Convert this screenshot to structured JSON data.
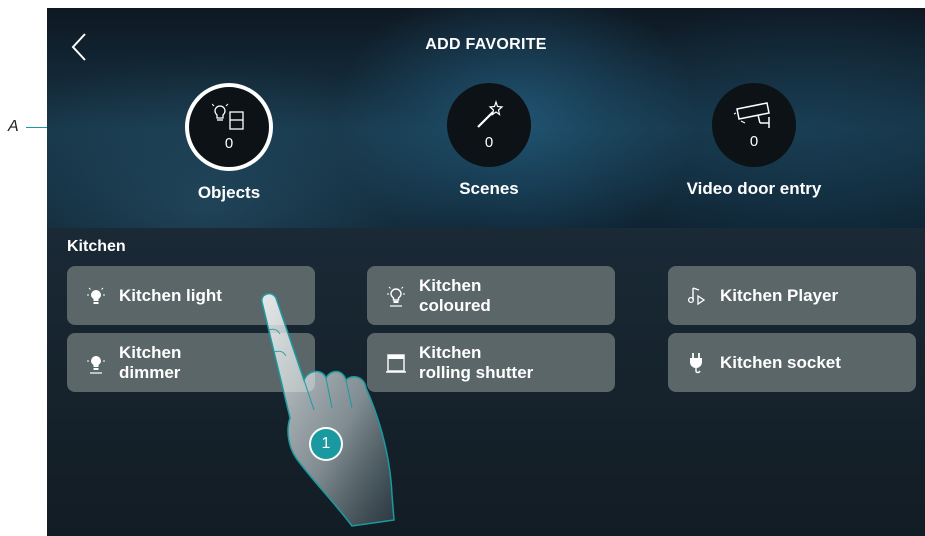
{
  "callout": {
    "letter": "A"
  },
  "header": {
    "title": "ADD FAVORITE"
  },
  "categories": [
    {
      "label": "Objects",
      "count": "0",
      "icon": "bulb-switch-icon",
      "active": true
    },
    {
      "label": "Scenes",
      "count": "0",
      "icon": "magic-wand-icon",
      "active": false
    },
    {
      "label": "Video door entry",
      "count": "0",
      "icon": "camera-icon",
      "active": false
    }
  ],
  "room": {
    "name": "Kitchen"
  },
  "devices": [
    {
      "label": "Kitchen light",
      "icon": "light-bulb-icon"
    },
    {
      "label": "Kitchen\ncoloured",
      "icon": "coloured-light-icon"
    },
    {
      "label": "Kitchen Player",
      "icon": "music-note-icon"
    },
    {
      "label": "Kitchen\ndimmer",
      "icon": "dimmer-bulb-icon"
    },
    {
      "label": "Kitchen\nrolling shutter",
      "icon": "shutter-icon"
    },
    {
      "label": "Kitchen socket",
      "icon": "plug-icon"
    }
  ],
  "step_badge": {
    "number": "1"
  },
  "colors": {
    "accent": "#1a9aa0",
    "tile": "#5b6669",
    "circle": "#0c1216"
  }
}
